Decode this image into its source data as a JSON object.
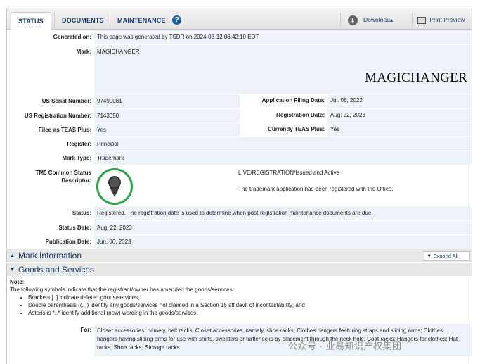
{
  "tabs": [
    {
      "label": "STATUS",
      "active": true
    },
    {
      "label": "DOCUMENTS",
      "active": false
    },
    {
      "label": "MAINTENANCE",
      "active": false
    }
  ],
  "toolbar": {
    "help_icon": "?",
    "download_label": "Download",
    "download_arrow": "▴",
    "print_label": "Print Preview"
  },
  "fields": {
    "generated_label": "Generated on:",
    "generated_value": "This page was generated by TSDR on 2024-03-12 06:42:10 EDT",
    "mark_label": "Mark:",
    "mark_value": "MAGICHANGER",
    "mark_image_text": "MAGICHANGER",
    "serial_label": "US Serial Number:",
    "serial_value": "97490081",
    "filing_label": "Application Filing Date:",
    "filing_value": "Jul. 06, 2022",
    "regnum_label": "US Registration Number:",
    "regnum_value": "7143050",
    "regdate_label": "Registration Date:",
    "regdate_value": "Aug. 22, 2023",
    "teas_label": "Filed as TEAS Plus:",
    "teas_value": "Yes",
    "curteas_label": "Currently TEAS Plus:",
    "curteas_value": "Yes",
    "register_label": "Register:",
    "register_value": "Principal",
    "marktype_label": "Mark Type:",
    "marktype_value": "Trademark",
    "tm5_label_1": "TM5 Common Status",
    "tm5_label_2": "Descriptor:",
    "tm5_status": "LIVE/REGISTRATION/Issued and Active",
    "tm5_desc": "The trademark application has been registered with the Office.",
    "status_label": "Status:",
    "status_value": "Registered. The registration date is used to determine when post-registration maintenance documents are due.",
    "statusdate_label": "Status Date:",
    "statusdate_value": "Aug. 22, 2023",
    "pubdate_label": "Publication Date:",
    "pubdate_value": "Jun. 06, 2023"
  },
  "sections": {
    "mark_info": "Mark Information",
    "mark_info_toggle": "▲",
    "expand_all": "▼ Expand All",
    "goods": "Goods and Services",
    "goods_toggle": "▼"
  },
  "note": {
    "title": "Note:",
    "intro": "The following symbols indicate that the registrant/owner has amended the goods/services:",
    "items": [
      "Brackets [..] indicate deleted goods/services;",
      "Double parenthesis ((..)) identify any goods/services not claimed in a Section 15 affidavit of incontestability; and",
      "Asterisks *..* identify additional (new) wording in the goods/services."
    ]
  },
  "goods": {
    "for_label": "For:",
    "for_value": "Closet accessories, namely, belt racks; Closet accessories, namely, shoe racks; Clothes hangers featuring straps and sliding arms; Clothes hangers having sliding arms for use with shirts, sweaters or turtlenecks by placement through the neck hole; Coat racks; Hangers for clothes; Hat racks; Shoe racks; Storage racks"
  },
  "watermark": "公众号 · 业易知识产权集团",
  "colors": {
    "accent": "#1b3f73",
    "value_bg": "#eef3fa",
    "section_bg": "#e7e7e7",
    "badge_green": "#2aa34a"
  },
  "icons": {
    "help": "question-circle-icon",
    "download": "download-arrow-icon",
    "print": "printer-icon",
    "badge": "registered-ribbon-badge-icon"
  }
}
